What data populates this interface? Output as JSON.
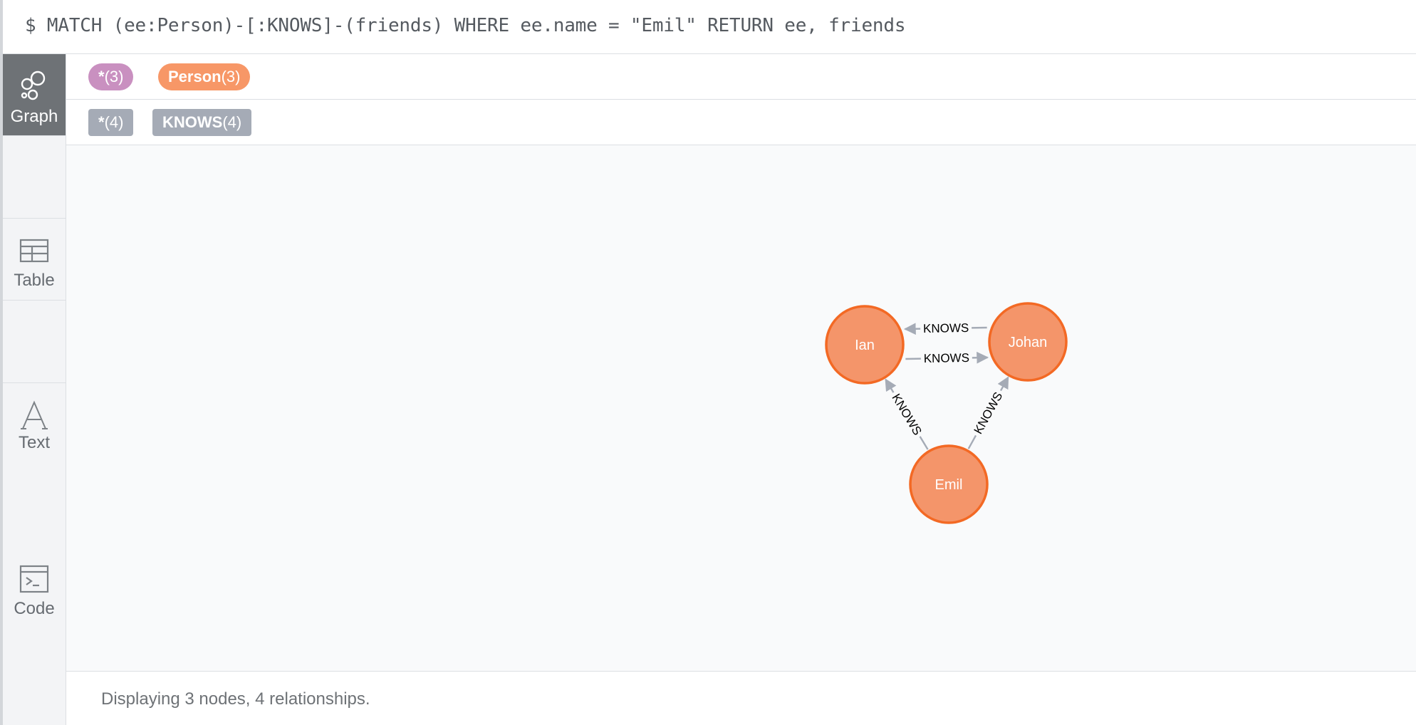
{
  "query": {
    "text": "$ MATCH (ee:Person)-[:KNOWS]-(friends) WHERE ee.name = \"Emil\" RETURN ee, friends"
  },
  "sidebar": {
    "items": [
      {
        "label": "Graph",
        "icon": "graph-icon",
        "active": true
      },
      {
        "label": "Table",
        "icon": "table-icon",
        "active": false
      },
      {
        "label": "Text",
        "icon": "text-icon",
        "active": false
      },
      {
        "label": "Code",
        "icon": "code-icon",
        "active": false
      }
    ]
  },
  "legend": {
    "nodes": [
      {
        "label": "*",
        "count": "(3)",
        "color": "#c990c0"
      },
      {
        "label": "Person",
        "count": "(3)",
        "color": "#f79767"
      }
    ],
    "relationships": [
      {
        "label": "*",
        "count": "(4)",
        "color": "#a5abb6"
      },
      {
        "label": "KNOWS",
        "count": "(4)",
        "color": "#a5abb6"
      }
    ]
  },
  "graph": {
    "node_fill": "#f4956a",
    "node_stroke": "#f36924",
    "edge_color": "#a5abb6",
    "nodes": [
      {
        "id": "ian",
        "name": "Ian"
      },
      {
        "id": "johan",
        "name": "Johan"
      },
      {
        "id": "emil",
        "name": "Emil"
      }
    ],
    "relationships": [
      {
        "from": "ian",
        "to": "johan",
        "type": "KNOWS"
      },
      {
        "from": "johan",
        "to": "ian",
        "type": "KNOWS"
      },
      {
        "from": "emil",
        "to": "ian",
        "type": "KNOWS"
      },
      {
        "from": "emil",
        "to": "johan",
        "type": "KNOWS"
      }
    ]
  },
  "status": {
    "text": "Displaying 3 nodes, 4 relationships."
  }
}
